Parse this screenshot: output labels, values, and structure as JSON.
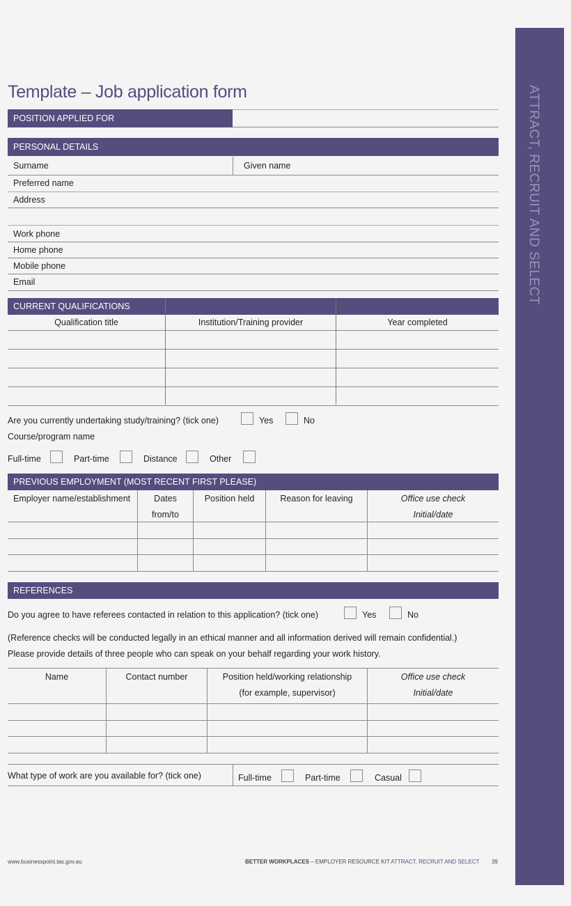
{
  "page": {
    "title": "Template – Job application form",
    "side_tab": "ATTRACT, RECRUIT AND SELECT"
  },
  "position": {
    "label": "POSITION APPLIED FOR",
    "value": ""
  },
  "personal": {
    "header": "PERSONAL DETAILS",
    "surname": "Surname",
    "given_name": "Given name",
    "preferred_name": "Preferred name",
    "address": "Address",
    "work_phone": "Work phone",
    "home_phone": "Home phone",
    "mobile_phone": "Mobile phone",
    "email": "Email"
  },
  "qualifications": {
    "header": "CURRENT QUALIFICATIONS",
    "columns": [
      "Qualification title",
      "Institution/Training provider",
      "Year completed"
    ],
    "rows": [
      [
        "",
        "",
        ""
      ],
      [
        "",
        "",
        ""
      ],
      [
        "",
        "",
        ""
      ],
      [
        "",
        "",
        ""
      ]
    ]
  },
  "study": {
    "question": "Are you currently undertaking study/training? (tick one)",
    "yes": "Yes",
    "no": "No",
    "course_label": "Course/program name",
    "modes": [
      "Full-time",
      "Part-time",
      "Distance",
      "Other"
    ]
  },
  "employment": {
    "header": "PREVIOUS EMPLOYMENT (MOST RECENT FIRST PLEASE)",
    "columns": [
      {
        "line1": "Employer name/establishment",
        "line2": ""
      },
      {
        "line1": "Dates",
        "line2": "from/to"
      },
      {
        "line1": "Position held",
        "line2": ""
      },
      {
        "line1": "Reason for leaving",
        "line2": ""
      },
      {
        "line1": "Office use check",
        "line2": "Initial/date"
      }
    ],
    "rows": [
      [
        "",
        "",
        "",
        "",
        ""
      ],
      [
        "",
        "",
        "",
        "",
        ""
      ],
      [
        "",
        "",
        "",
        "",
        ""
      ]
    ]
  },
  "references": {
    "header": "REFERENCES",
    "question": "Do you agree to have referees contacted in relation to this application? (tick one)",
    "yes": "Yes",
    "no": "No",
    "note": "(Reference checks will be conducted legally in an ethical manner and all information derived will remain confidential.)",
    "instruction": "Please provide details of three people who can speak on your behalf regarding your work history.",
    "columns": [
      {
        "line1": "Name",
        "line2": ""
      },
      {
        "line1": "Contact number",
        "line2": ""
      },
      {
        "line1": "Position held/working relationship",
        "line2": "(for example, supervisor)"
      },
      {
        "line1": "Office use check",
        "line2": "Initial/date"
      }
    ],
    "rows": [
      [
        "",
        "",
        "",
        ""
      ],
      [
        "",
        "",
        "",
        ""
      ],
      [
        "",
        "",
        "",
        ""
      ]
    ]
  },
  "availability": {
    "question": "What type of work are you available for? (tick one)",
    "options": [
      "Full-time",
      "Part-time",
      "Casual"
    ]
  },
  "footer": {
    "url": "www.businesspoint.tas.gov.au",
    "publication_bold": "BETTER WORKPLACES",
    "publication_rest": " – EMPLOYER RESOURCE KIT ",
    "section": "ATTRACT, RECRUIT AND SELECT",
    "page_number": "39"
  }
}
